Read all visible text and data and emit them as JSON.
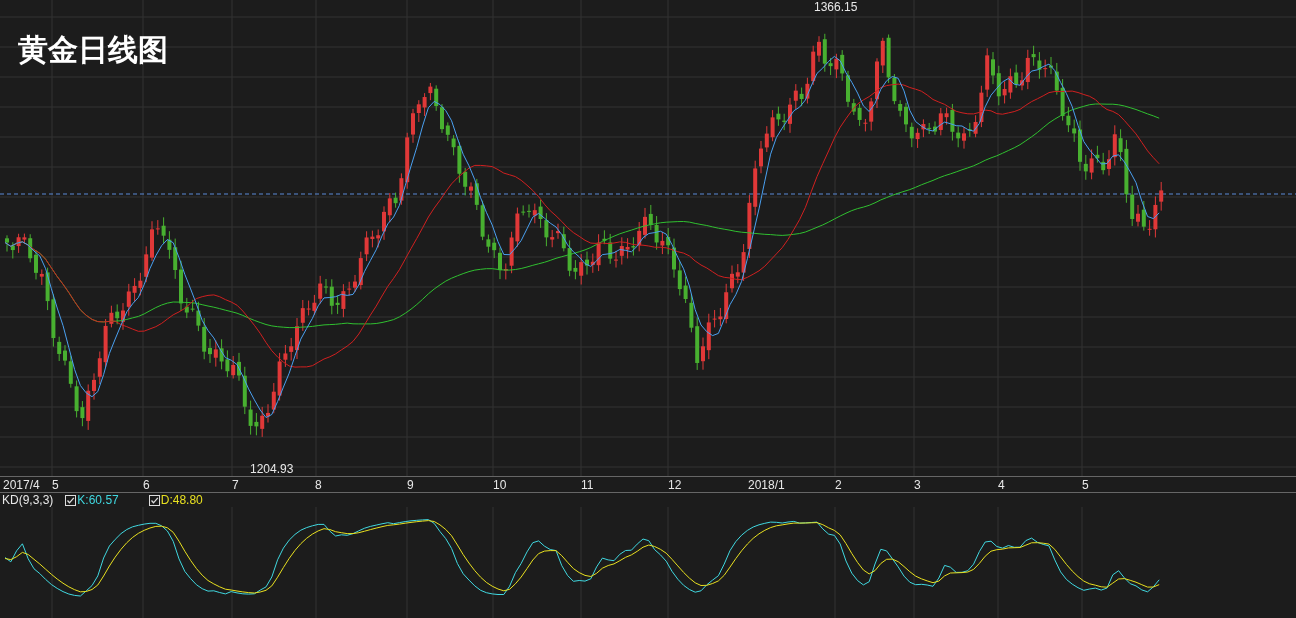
{
  "chart": {
    "title": "黄金日线图",
    "high_label": "1366.15",
    "low_label": "1204.93"
  },
  "x_axis": [
    "2017/4",
    "5",
    "6",
    "7",
    "8",
    "9",
    "10",
    "11",
    "12",
    "2018/1",
    "2",
    "3",
    "4",
    "5"
  ],
  "kd": {
    "label": "KD(9,3,3)",
    "lines": [
      {
        "label": "K:60.57",
        "checked": true,
        "color": "#40d8e0"
      },
      {
        "label": "D:48.80",
        "checked": true,
        "color": "#e8e020"
      }
    ]
  }
}
